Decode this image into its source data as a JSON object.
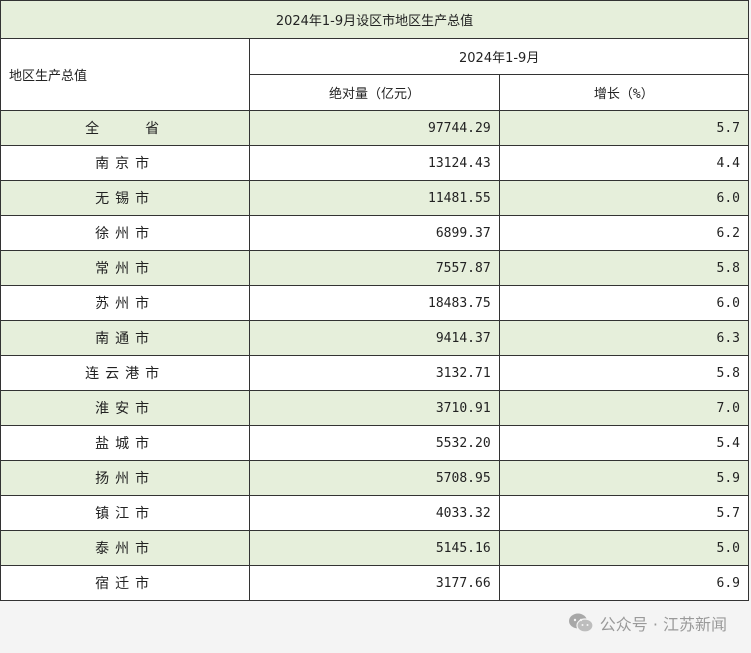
{
  "table": {
    "title": "2024年1-9月设区市地区生产总值",
    "row_header": "地区生产总值",
    "period": "2024年1-9月",
    "col_value": "绝对量（亿元）",
    "col_growth": "增长（%）",
    "rows": [
      {
        "name": "全　　省",
        "value": "97744.29",
        "growth": "5.7"
      },
      {
        "name": "南京市",
        "value": "13124.43",
        "growth": "4.4"
      },
      {
        "name": "无锡市",
        "value": "11481.55",
        "growth": "6.0"
      },
      {
        "name": "徐州市",
        "value": "6899.37",
        "growth": "6.2"
      },
      {
        "name": "常州市",
        "value": "7557.87",
        "growth": "5.8"
      },
      {
        "name": "苏州市",
        "value": "18483.75",
        "growth": "6.0"
      },
      {
        "name": "南通市",
        "value": "9414.37",
        "growth": "6.3"
      },
      {
        "name": "连云港市",
        "value": "3132.71",
        "growth": "5.8"
      },
      {
        "name": "淮安市",
        "value": "3710.91",
        "growth": "7.0"
      },
      {
        "name": "盐城市",
        "value": "5532.20",
        "growth": "5.4"
      },
      {
        "name": "扬州市",
        "value": "5708.95",
        "growth": "5.9"
      },
      {
        "name": "镇江市",
        "value": "4033.32",
        "growth": "5.7"
      },
      {
        "name": "泰州市",
        "value": "5145.16",
        "growth": "5.0"
      },
      {
        "name": "宿迁市",
        "value": "3177.66",
        "growth": "6.9"
      }
    ]
  },
  "watermark": {
    "text": "公众号 · 江苏新闻",
    "icon": "wechat-icon",
    "color": "#9a9a9a"
  },
  "colors": {
    "row_highlight": "#e6efdb",
    "border": "#333333"
  }
}
